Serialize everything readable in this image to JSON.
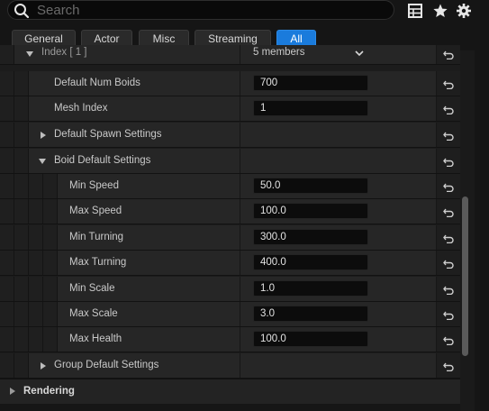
{
  "search": {
    "placeholder": "Search"
  },
  "toolbar": {
    "icons": [
      "table-icon",
      "star-icon",
      "gear-icon"
    ]
  },
  "filter_tabs": [
    {
      "label": "General",
      "active": false
    },
    {
      "label": "Actor",
      "active": false
    },
    {
      "label": "Misc",
      "active": false
    },
    {
      "label": "Streaming",
      "active": false
    },
    {
      "label": "All",
      "active": true
    }
  ],
  "index_row": {
    "label": "Index [ 1 ]",
    "value": "5 members"
  },
  "properties": {
    "default_num_boids": {
      "label": "Default Num Boids",
      "value": "700"
    },
    "mesh_index": {
      "label": "Mesh Index",
      "value": "1"
    },
    "default_spawn_settings": {
      "label": "Default Spawn Settings"
    },
    "boid_default_settings": {
      "label": "Boid Default Settings",
      "items": [
        {
          "label": "Min Speed",
          "value": "50.0"
        },
        {
          "label": "Max Speed",
          "value": "100.0"
        },
        {
          "label": "Min Turning",
          "value": "300.0"
        },
        {
          "label": "Max Turning",
          "value": "400.0"
        },
        {
          "label": "Min Scale",
          "value": "1.0"
        },
        {
          "label": "Max Scale",
          "value": "3.0"
        },
        {
          "label": "Max Health",
          "value": "100.0"
        }
      ]
    },
    "group_default_settings": {
      "label": "Group Default Settings"
    }
  },
  "rendering_section": {
    "label": "Rendering"
  },
  "colors": {
    "accent": "#1a7bdc",
    "panel": "#262626",
    "field": "#0c0c0c"
  }
}
